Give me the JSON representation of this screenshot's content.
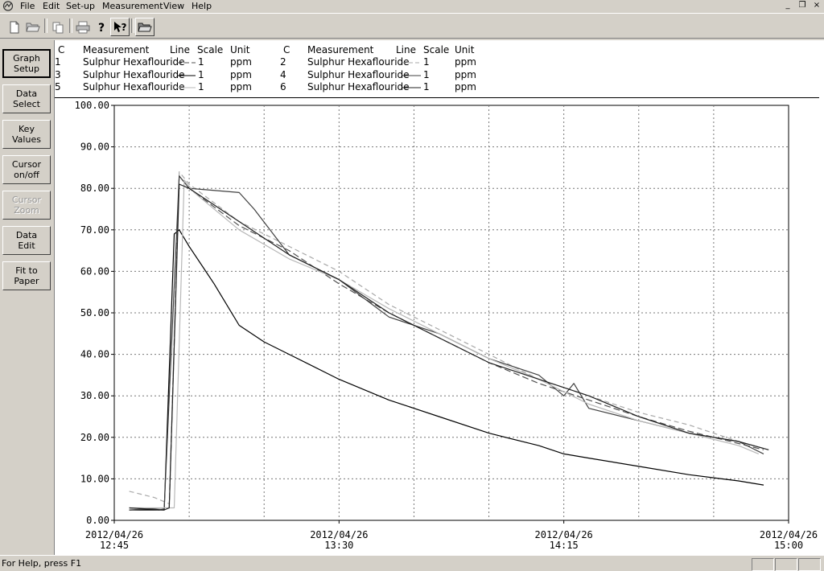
{
  "menu": {
    "items": [
      "File",
      "Edit",
      "Set-up",
      "Measurement",
      "View",
      "Help"
    ]
  },
  "window_controls": [
    "_",
    "❐",
    "×"
  ],
  "toolbar": {
    "icons": [
      "new-file-icon",
      "open-file-icon",
      "copy-icon",
      "print-icon",
      "help-icon",
      "context-help-icon",
      "open-folder-icon"
    ]
  },
  "side_buttons": [
    {
      "label": "Graph\nSetup",
      "state": "pressed"
    },
    {
      "label": "Data\nSelect",
      "state": "normal"
    },
    {
      "label": "Key\nValues",
      "state": "normal"
    },
    {
      "label": "Cursor\non/off",
      "state": "normal"
    },
    {
      "label": "Cursor\nZoom",
      "state": "disabled"
    },
    {
      "label": "Data\nEdit",
      "state": "normal"
    },
    {
      "label": "Fit to\nPaper",
      "state": "normal"
    }
  ],
  "legend": {
    "headers": {
      "c": "C",
      "measurement": "Measurement",
      "line": "Line",
      "scale": "Scale",
      "unit": "Unit"
    },
    "rows": [
      {
        "c": "1",
        "measurement": "Sulphur Hexaflouride",
        "scale": "1",
        "unit": "ppm"
      },
      {
        "c": "2",
        "measurement": "Sulphur Hexaflouride",
        "scale": "1",
        "unit": "ppm"
      },
      {
        "c": "3",
        "measurement": "Sulphur Hexaflouride",
        "scale": "1",
        "unit": "ppm"
      },
      {
        "c": "4",
        "measurement": "Sulphur Hexaflouride",
        "scale": "1",
        "unit": "ppm"
      },
      {
        "c": "5",
        "measurement": "Sulphur Hexaflouride",
        "scale": "1",
        "unit": "ppm"
      },
      {
        "c": "6",
        "measurement": "Sulphur Hexaflouride",
        "scale": "1",
        "unit": "ppm"
      }
    ]
  },
  "chart_data": {
    "type": "line",
    "title": "",
    "xlabel": "",
    "ylabel": "",
    "x_unit": "minutes",
    "xlim": [
      "12:45",
      "15:00"
    ],
    "ylim": [
      0,
      100
    ],
    "grid": true,
    "y_ticks": [
      "0.00",
      "10.00",
      "20.00",
      "30.00",
      "40.00",
      "50.00",
      "60.00",
      "70.00",
      "80.00",
      "90.00",
      "100.00"
    ],
    "x_ticks": [
      {
        "date": "2012/04/26",
        "time": "12:45"
      },
      {
        "date": "2012/04/26",
        "time": "13:30"
      },
      {
        "date": "2012/04/26",
        "time": "14:15"
      },
      {
        "date": "2012/04/26",
        "time": "15:00"
      }
    ],
    "series": [
      {
        "name": "Sulphur Hexaflouride",
        "channel": "1",
        "color": "#505050",
        "dash": "8,4",
        "x": [
          "12:48",
          "12:54",
          "12:56",
          "12:58",
          "13:00",
          "13:10",
          "13:20",
          "13:30",
          "13:40",
          "13:50",
          "14:00",
          "14:10",
          "14:20",
          "14:30",
          "14:40",
          "14:50",
          "14:55"
        ],
        "y": [
          3,
          2.5,
          3,
          83,
          80,
          71,
          65,
          57,
          50,
          44,
          38,
          33,
          29,
          25,
          21.5,
          18.5,
          17
        ]
      },
      {
        "name": "Sulphur Hexaflouride",
        "channel": "2",
        "color": "#a8a8a8",
        "dash": "6,4",
        "x": [
          "12:48",
          "12:53",
          "12:56",
          "12:58",
          "13:00",
          "13:10",
          "13:20",
          "13:30",
          "13:40",
          "13:50",
          "14:00",
          "14:10",
          "14:20",
          "14:30",
          "14:40",
          "14:50",
          "14:56"
        ],
        "y": [
          7,
          5.5,
          4,
          84,
          81,
          72,
          66,
          60,
          52,
          46,
          40,
          34,
          30,
          26,
          23,
          19,
          17
        ]
      },
      {
        "name": "Sulphur Hexaflouride",
        "channel": "3",
        "color": "#000000",
        "dash": "",
        "x": [
          "12:48",
          "12:55",
          "12:57",
          "12:58",
          "13:00",
          "13:05",
          "13:10",
          "13:15",
          "13:20",
          "13:30",
          "13:40",
          "13:50",
          "14:00",
          "14:10",
          "14:15",
          "14:20",
          "14:30",
          "14:40",
          "14:50",
          "14:55"
        ],
        "y": [
          2.5,
          2.5,
          69,
          70,
          66,
          57,
          47,
          43,
          40,
          34,
          29,
          25,
          21,
          18,
          16,
          15,
          13,
          11,
          9.5,
          8.5
        ]
      },
      {
        "name": "Sulphur Hexaflouride",
        "channel": "4",
        "color": "#404040",
        "dash": "",
        "x": [
          "12:48",
          "12:55",
          "12:58",
          "13:00",
          "13:10",
          "13:13",
          "13:20",
          "13:30",
          "13:40",
          "13:50",
          "14:00",
          "14:10",
          "14:15",
          "14:17",
          "14:20",
          "14:30",
          "14:40",
          "14:50",
          "14:55"
        ],
        "y": [
          2.5,
          3,
          83,
          80,
          79,
          75,
          64,
          58,
          49,
          45,
          39,
          35,
          30,
          33,
          27,
          24,
          21,
          19,
          16
        ]
      },
      {
        "name": "Sulphur Hexaflouride",
        "channel": "5",
        "color": "#b8b8b8",
        "dash": "",
        "x": [
          "12:48",
          "12:55",
          "12:57",
          "12:59",
          "13:01",
          "13:10",
          "13:20",
          "13:30",
          "13:40",
          "13:50",
          "14:00",
          "14:10",
          "14:20",
          "14:30",
          "14:40",
          "14:50",
          "14:54"
        ],
        "y": [
          3,
          3,
          3,
          82,
          79,
          70,
          63,
          58,
          51,
          45,
          39,
          34,
          28,
          24,
          21,
          18,
          16
        ]
      },
      {
        "name": "Sulphur Hexaflouride",
        "channel": "6",
        "color": "#202020",
        "dash": "",
        "x": [
          "12:48",
          "12:55",
          "12:56",
          "12:58",
          "13:00",
          "13:10",
          "13:20",
          "13:30",
          "13:40",
          "13:50",
          "14:00",
          "14:10",
          "14:20",
          "14:30",
          "14:40",
          "14:50",
          "14:56"
        ],
        "y": [
          3,
          2.5,
          3,
          81,
          80,
          72,
          64,
          58,
          50,
          44,
          38,
          34,
          30,
          25,
          21,
          19,
          17
        ]
      }
    ]
  },
  "status": {
    "help_text": "For Help, press F1"
  }
}
